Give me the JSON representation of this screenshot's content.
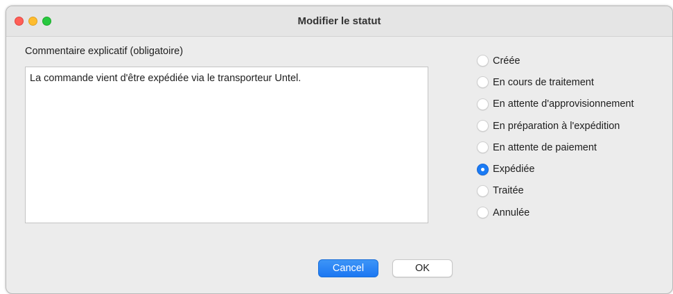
{
  "window": {
    "title": "Modifier le statut"
  },
  "comment": {
    "label": "Commentaire explicatif (obligatoire)",
    "value": "La commande vient d'être expédiée via le transporteur Untel."
  },
  "status": {
    "selected": "Expédiée",
    "options": [
      "Créée",
      "En cours de traitement",
      "En attente d'approvisionnement",
      "En préparation à l'expédition",
      "En attente de paiement",
      "Expédiée",
      "Traitée",
      "Annulée"
    ]
  },
  "buttons": {
    "cancel_label": "Cancel",
    "ok_label": "OK"
  },
  "colors": {
    "accent": "#1a7bf5",
    "window_bg": "#ececec",
    "close": "#ff5f57",
    "minimize": "#febc2e",
    "maximize": "#28c840"
  }
}
